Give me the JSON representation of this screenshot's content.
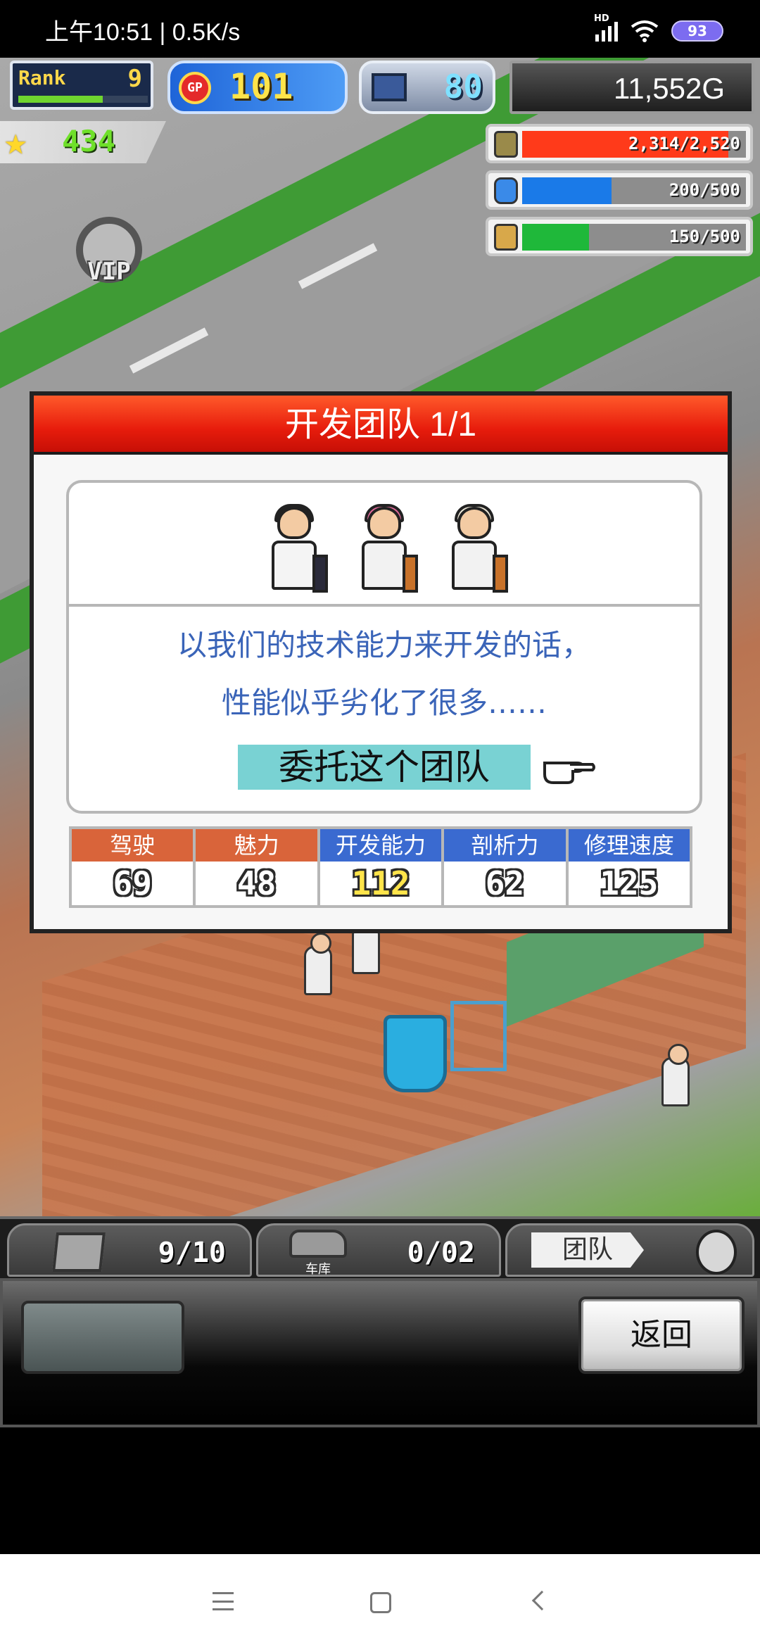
{
  "status_bar": {
    "time": "上午10:51 | 0.5K/s",
    "network": "HD",
    "battery": "93"
  },
  "hud": {
    "rank_label": "Rank",
    "rank_value": "9",
    "rank_progress": 0.65,
    "gp_label": "GP",
    "gp_value": "101",
    "research_value": "80",
    "money": "11,552G",
    "stars": "434",
    "resources": [
      {
        "name": "parts",
        "icon": "barrel-icon",
        "text": "2,314/2,520",
        "fraction": 0.92,
        "color": "#ff3a1a"
      },
      {
        "name": "fuel",
        "icon": "bottle-icon",
        "text": "200/500",
        "fraction": 0.4,
        "color": "#1a7ae8"
      },
      {
        "name": "wheat",
        "icon": "wheat-icon",
        "text": "150/500",
        "fraction": 0.3,
        "color": "#1fb83a"
      }
    ],
    "vip_label": "VIP"
  },
  "dialog": {
    "title": "开发团队 1/1",
    "message_line1": "以我们的技术能力来开发的话，",
    "message_line2": "性能似乎劣化了很多……",
    "entrust_label": "委托这个团队",
    "stats": [
      {
        "label": "驾驶",
        "value": "69",
        "header_color": "#d9643a",
        "highlight": false
      },
      {
        "label": "魅力",
        "value": "48",
        "header_color": "#d9643a",
        "highlight": false
      },
      {
        "label": "开发能力",
        "value": "112",
        "header_color": "#3a6ad0",
        "highlight": true
      },
      {
        "label": "剖析力",
        "value": "62",
        "header_color": "#3a6ad0",
        "highlight": false
      },
      {
        "label": "修理速度",
        "value": "125",
        "header_color": "#3a6ad0",
        "highlight": false
      }
    ]
  },
  "bottom_tabs": {
    "items_count": "9/10",
    "garage_label": "车库",
    "garage_count": "0/02",
    "team_label": "团队"
  },
  "command_bar": {
    "back_label": "返回"
  }
}
